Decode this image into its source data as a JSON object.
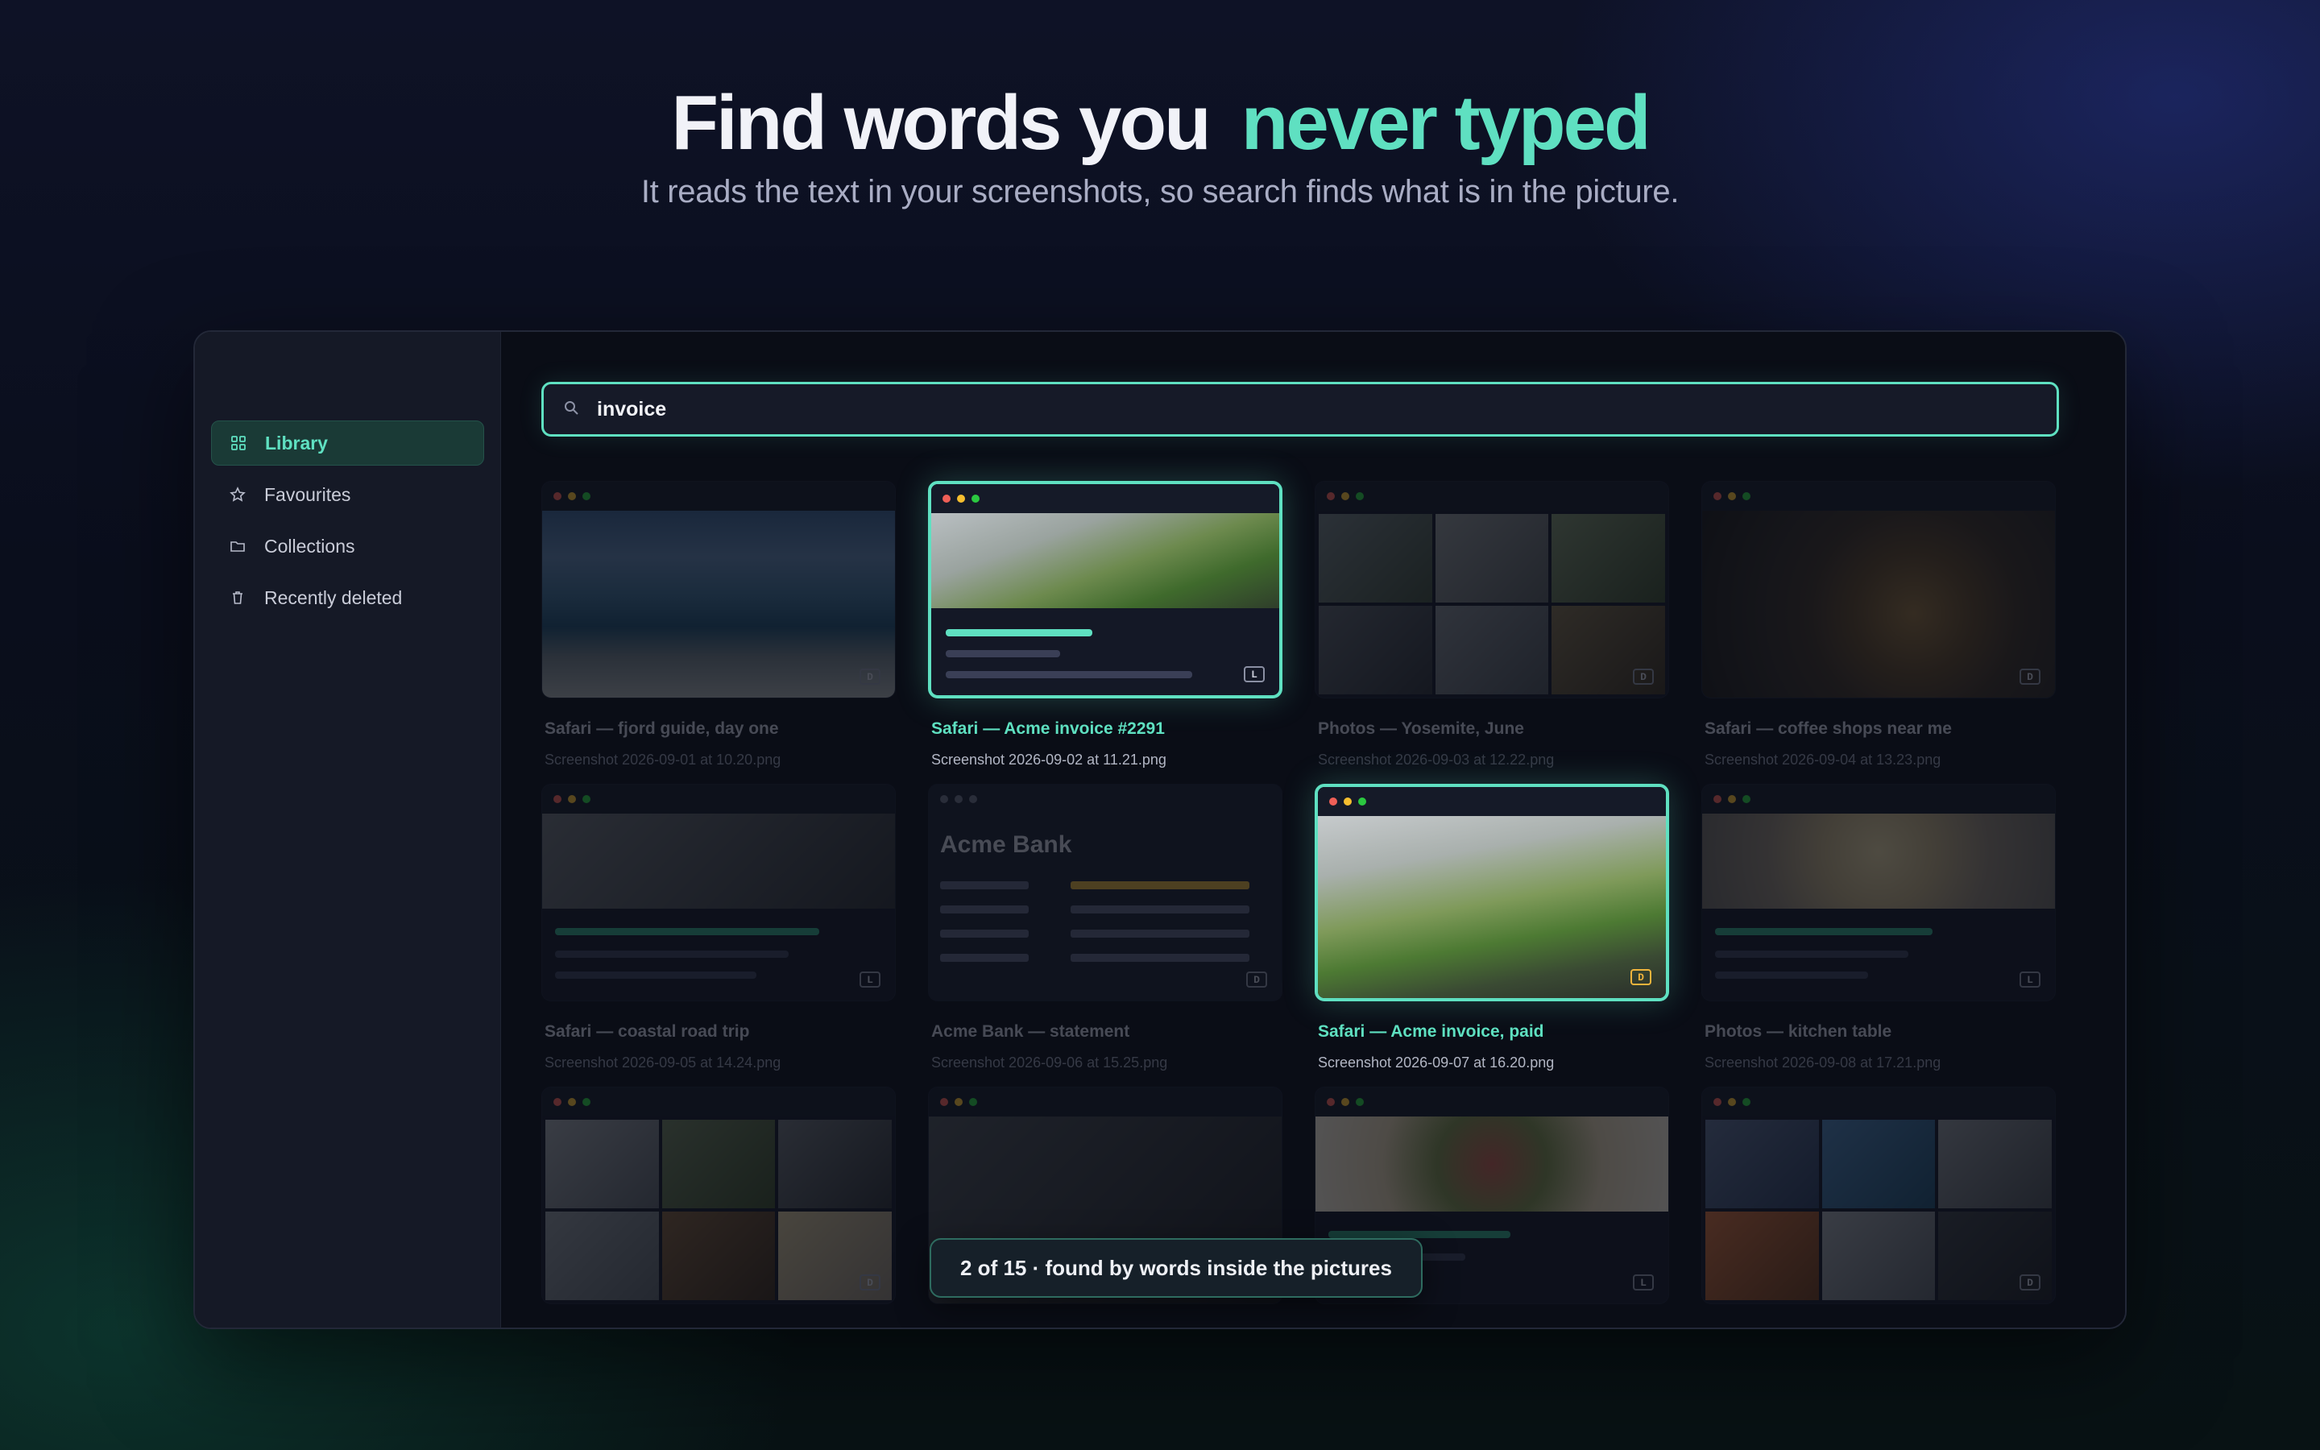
{
  "hero": {
    "title_main": "Find words you",
    "title_accent": "never typed",
    "subtitle": "It reads the text in your screenshots, so search finds what is in the picture."
  },
  "sidebar": {
    "items": [
      {
        "label": "Library",
        "icon": "grid-icon",
        "active": true
      },
      {
        "label": "Favourites",
        "icon": "star-icon",
        "active": false
      },
      {
        "label": "Collections",
        "icon": "folder-icon",
        "active": false
      },
      {
        "label": "Recently deleted",
        "icon": "trash-icon",
        "active": false
      }
    ]
  },
  "search": {
    "value": "invoice",
    "icon": "search-icon"
  },
  "cards": [
    {
      "title": "Safari — fjord guide, day one",
      "subtitle": "Screenshot 2026-09-01 at 10.20.png",
      "badge": "D",
      "highlighted": false
    },
    {
      "title": "Safari — Acme invoice #2291",
      "subtitle": "Screenshot 2026-09-02 at 11.21.png",
      "badge": "L",
      "highlighted": true
    },
    {
      "title": "Photos — Yosemite, June",
      "subtitle": "Screenshot 2026-09-03 at 12.22.png",
      "badge": "D",
      "highlighted": false
    },
    {
      "title": "Safari — coffee shops near me",
      "subtitle": "Screenshot 2026-09-04 at 13.23.png",
      "badge": "D",
      "highlighted": false
    },
    {
      "title": "Safari — coastal road trip",
      "subtitle": "Screenshot 2026-09-05 at 14.24.png",
      "badge": "L",
      "highlighted": false
    },
    {
      "title": "Acme Bank — statement",
      "subtitle": "Screenshot 2026-09-06 at 15.25.png",
      "badge": "D",
      "highlighted": false,
      "preview_heading": "Acme Bank"
    },
    {
      "title": "Safari — Acme invoice, paid",
      "subtitle": "Screenshot 2026-09-07 at 16.20.png",
      "badge": "D",
      "highlighted": true
    },
    {
      "title": "Photos — kitchen table",
      "subtitle": "Screenshot 2026-09-08 at 17.21.png",
      "badge": "L",
      "highlighted": false
    },
    {
      "badge": "D",
      "highlighted": false
    },
    {
      "badge": "",
      "highlighted": false
    },
    {
      "badge": "L",
      "highlighted": false
    },
    {
      "badge": "D",
      "highlighted": false
    }
  ],
  "status": {
    "text": "2 of 15 · found by words inside the pictures"
  },
  "colors": {
    "accent": "#5fe0c1",
    "background": "#0a0d16",
    "sidebar": "#151926",
    "badge_gold": "#f0b43c"
  }
}
